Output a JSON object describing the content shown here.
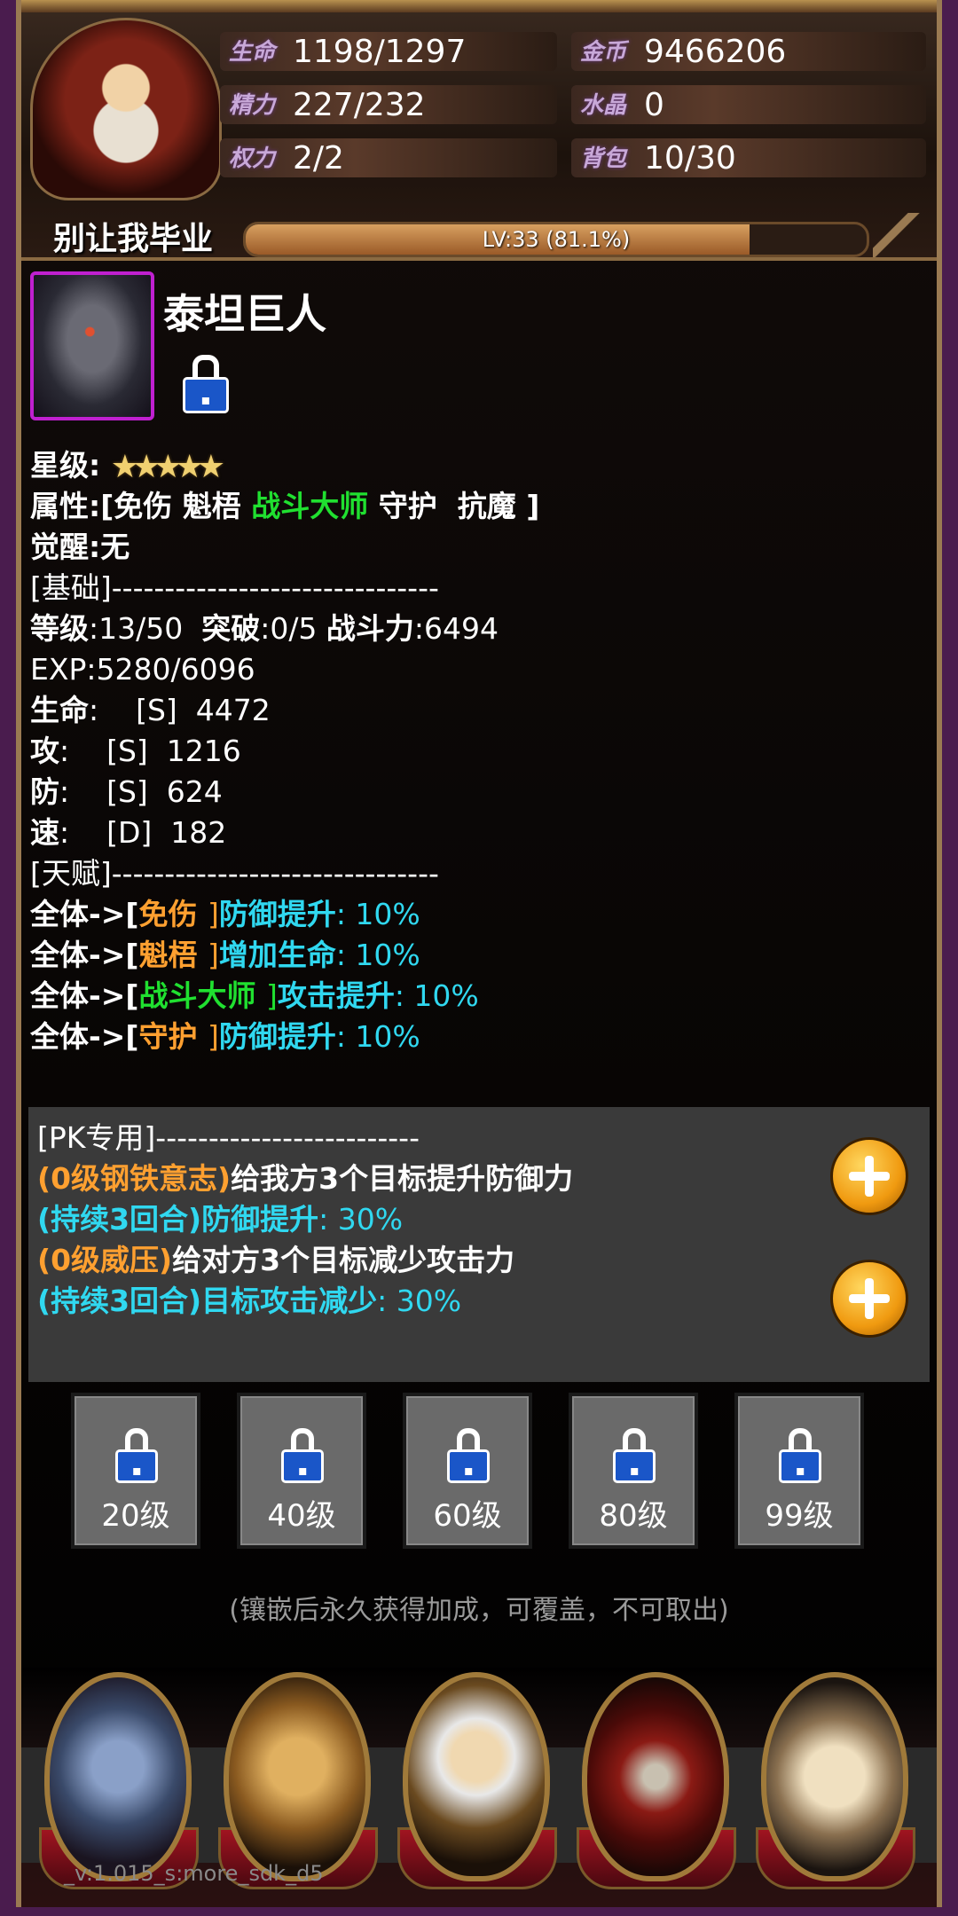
{
  "header": {
    "stats": [
      {
        "label": "生命",
        "value": "1198/1297"
      },
      {
        "label": "精力",
        "value": "227/232"
      },
      {
        "label": "权力",
        "value": "2/2"
      },
      {
        "label": "金币",
        "value": "9466206"
      },
      {
        "label": "水晶",
        "value": "0"
      },
      {
        "label": "背包",
        "value": "10/30"
      }
    ],
    "player_name": "别让我毕业",
    "level_text": "LV:33 (81.1%)",
    "level_progress_percent": 81.1
  },
  "hero": {
    "name": "泰坦巨人",
    "stars": "★★★★★",
    "lines": {
      "star_label": "星级:",
      "attr_prefix": "属性:[免伤 魁梧 ",
      "attr_green": "战斗大师",
      "attr_suffix": " 守护  抗魔 ]",
      "awaken": "觉醒:无",
      "basic_header": "[基础]-------------------------------",
      "level_a": "等级",
      "level_b": ":13/50  ",
      "break_a": "突破",
      "break_b": ":0/5 ",
      "power_a": "战斗力",
      "power_b": ":6494",
      "exp": "EXP:5280/6096",
      "hp_a": "生命",
      "hp_b": ":    [S]  4472",
      "atk_a": "攻",
      "atk_b": ":    [S]  1216",
      "def_a": "防",
      "def_b": ":    [S]  624",
      "spd_a": "速",
      "spd_b": ":    [D]  182",
      "talent_header": "[天赋]-------------------------------"
    },
    "talents": [
      {
        "who": "全体->[",
        "name": "免伤 ",
        "name_color": "o",
        "close": "]",
        "effect": "防御提升",
        "value": ": 10%"
      },
      {
        "who": "全体->[",
        "name": "魁梧 ",
        "name_color": "o",
        "close": "]",
        "effect": "增加生命",
        "value": ": 10%"
      },
      {
        "who": "全体->[",
        "name": "战斗大师 ",
        "name_color": "g",
        "close": "]",
        "effect": "攻击提升",
        "value": ": 10%"
      },
      {
        "who": "全体->[",
        "name": "守护 ",
        "name_color": "o",
        "close": "]",
        "effect": "防御提升",
        "value": ": 10%"
      }
    ]
  },
  "pk": {
    "header": "[PK专用]-------------------------",
    "skills": [
      {
        "name": "(0级钢铁意志)",
        "desc": "给我方3个目标提升防御力",
        "duration": "(持续3回合)",
        "effect": "防御提升",
        "value": ": 30%"
      },
      {
        "name": "(0级威压)",
        "desc": "给对方3个目标减少攻击力",
        "duration": "(持续3回合)",
        "effect": "目标攻击减少",
        "value": ": 30%"
      }
    ]
  },
  "slots": [
    "20级",
    "40级",
    "60级",
    "80级",
    "99级"
  ],
  "hint": "(镶嵌后永久获得加成，可覆盖，不可取出)",
  "nav": {
    "buttons": [
      "armory-emblem",
      "warrior-helmet",
      "priest-mask",
      "treasure-chest",
      "spell-book"
    ]
  },
  "version": "_v:1.015_s:more_sdk_d5",
  "colors": {
    "green": "#20e030",
    "orange": "#ffa030",
    "cyan": "#30d8f0",
    "frame": "#4a1c4e"
  }
}
